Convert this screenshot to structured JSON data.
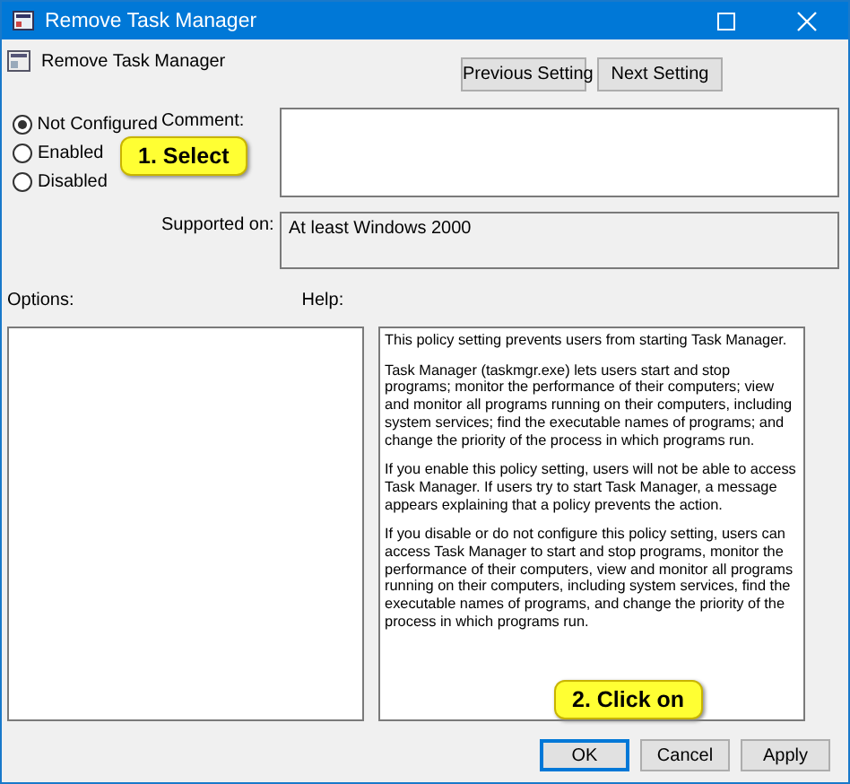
{
  "window": {
    "title": "Remove Task Manager"
  },
  "header": {
    "title": "Remove Task Manager"
  },
  "nav_buttons": [
    {
      "label": "Previous Setting"
    },
    {
      "label": "Next Setting"
    }
  ],
  "options": [
    {
      "label": "Not Configured",
      "selected": true
    },
    {
      "label": "Enabled",
      "selected": false
    },
    {
      "label": "Disabled",
      "selected": false
    }
  ],
  "comment": {
    "label": "Comment:"
  },
  "supported_on": {
    "label": "Supported on:",
    "value": "At least Windows 2000"
  },
  "options_label": "Options:",
  "help": {
    "label": "Help:",
    "paragraphs": [
      "This policy setting prevents users from starting Task Manager.",
      "Task Manager (taskmgr.exe) lets users start and stop programs; monitor the performance of their computers; view and monitor all programs running on their computers, including system services; find the executable names of programs; and change the priority of the process in which programs run.",
      "If you enable this policy setting, users will not be able to access Task Manager. If users try to start Task Manager, a message appears explaining that a policy prevents the action.",
      "If you disable or do not configure this policy setting, users can access Task Manager to  start and stop programs, monitor the performance of their computers, view and monitor all programs running on their computers, including system services, find the executable names of programs, and change the priority of the process in which programs run."
    ]
  },
  "buttons": [
    {
      "label": "OK",
      "selected": true
    },
    {
      "label": "Cancel",
      "selected": false
    },
    {
      "label": "Apply",
      "selected": false
    }
  ],
  "callouts": [
    {
      "text": "1. Select"
    },
    {
      "text": "2. Click on"
    }
  ]
}
